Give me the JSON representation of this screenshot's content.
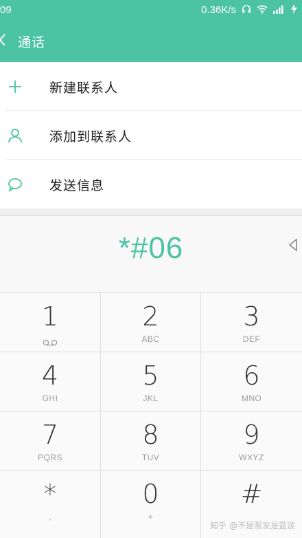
{
  "status_bar": {
    "time": "09",
    "speed": "0.36K/s"
  },
  "header": {
    "title": "通话",
    "back_icon": "chevron-left-icon"
  },
  "actions": [
    {
      "label": "新建联系人",
      "icon": "plus-icon"
    },
    {
      "label": "添加到联系人",
      "icon": "person-icon"
    },
    {
      "label": "发送信息",
      "icon": "message-bubble-icon"
    }
  ],
  "dialer": {
    "number": "*#06"
  },
  "keys": [
    {
      "digit": "1",
      "letters": ""
    },
    {
      "digit": "2",
      "letters": "ABC"
    },
    {
      "digit": "3",
      "letters": "DEF"
    },
    {
      "digit": "4",
      "letters": "GHI"
    },
    {
      "digit": "5",
      "letters": "JKL"
    },
    {
      "digit": "6",
      "letters": "MNO"
    },
    {
      "digit": "7",
      "letters": "PQRS"
    },
    {
      "digit": "8",
      "letters": "TUV"
    },
    {
      "digit": "9",
      "letters": "WXYZ"
    },
    {
      "digit": "*",
      "letters": ","
    },
    {
      "digit": "0",
      "letters": "+"
    },
    {
      "digit": "#",
      "letters": ""
    }
  ],
  "watermark": "知乎 @不是限发是蓝波",
  "colors": {
    "accent": "#4cc3a2",
    "text": "#333333",
    "subtext": "#9a9a9a"
  }
}
